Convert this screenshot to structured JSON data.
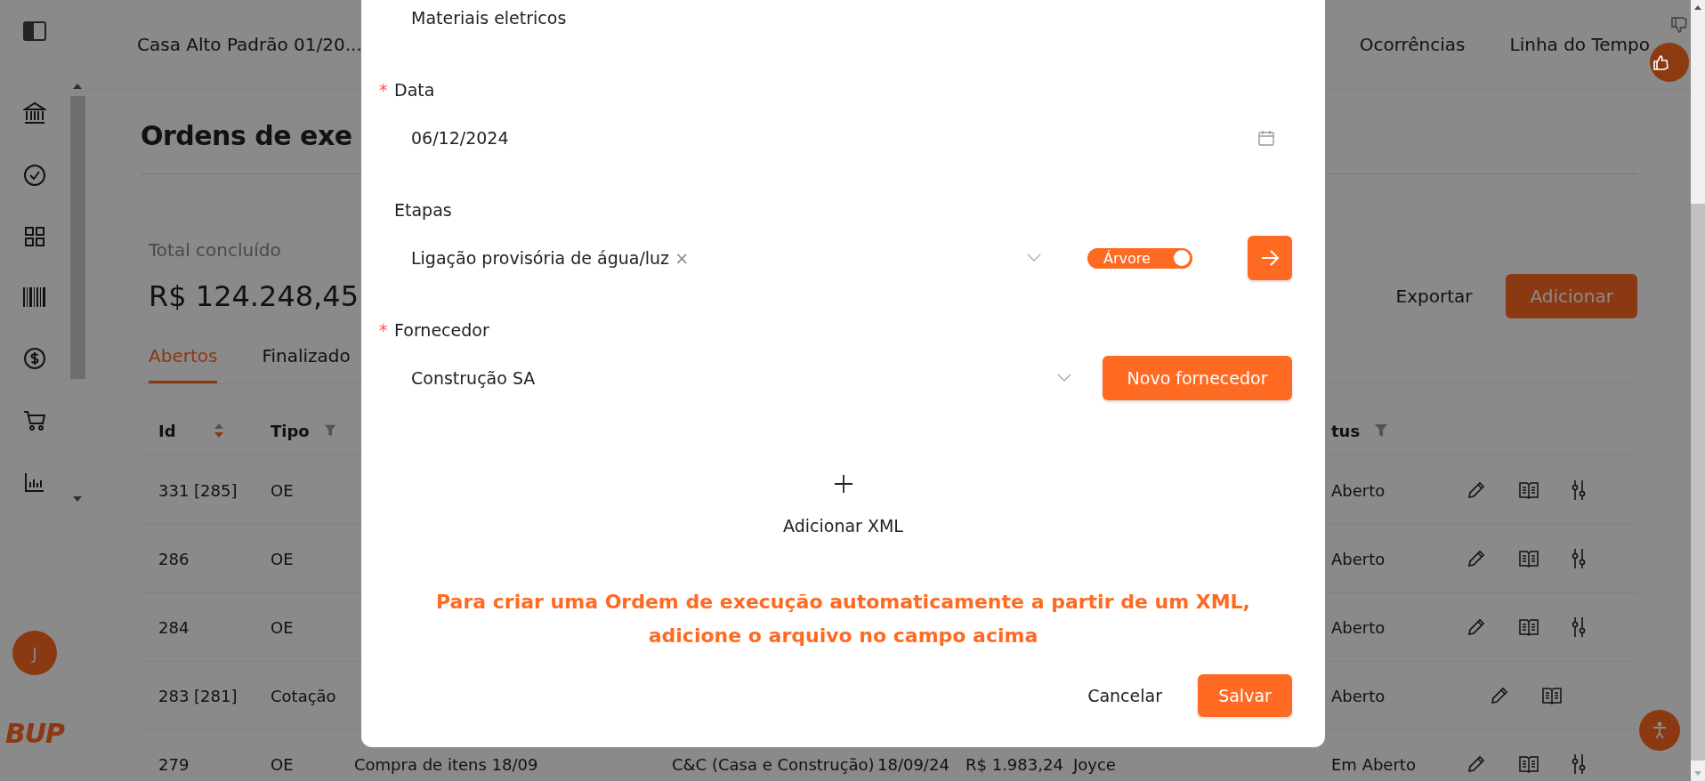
{
  "sidebar": {
    "avatar": "J",
    "logo": "BUP"
  },
  "header": {
    "project": "Casa Alto Padrão 01/20...",
    "nav": [
      "Ocorrências",
      "Linha do Tempo"
    ]
  },
  "page": {
    "title": "Ordens de exe",
    "total_label": "Total concluído",
    "total_value": "R$ 124.248,45",
    "tabs": [
      {
        "label": "Abertos",
        "selected": true
      },
      {
        "label": "Finalizado",
        "selected": false
      }
    ],
    "export": "Exportar",
    "add": "Adicionar"
  },
  "table": {
    "columns": [
      {
        "label": "Id",
        "sort_descending": true
      },
      {
        "label": "Tipo",
        "filter": true
      },
      {
        "label": "tus",
        "filter": true
      }
    ],
    "rows": [
      {
        "id": "331 [285]",
        "tipo": "OE",
        "status": "Aberto",
        "actions": [
          {
            "kind": "edit"
          },
          {
            "kind": "book"
          },
          {
            "kind": "sliders"
          }
        ]
      },
      {
        "id": "286",
        "tipo": "OE",
        "status": "Aberto",
        "actions": [
          {
            "kind": "edit"
          },
          {
            "kind": "book"
          },
          {
            "kind": "sliders"
          }
        ]
      },
      {
        "id": "284",
        "tipo": "OE",
        "status": "Aberto",
        "actions": [
          {
            "kind": "edit"
          },
          {
            "kind": "book"
          },
          {
            "kind": "sliders"
          }
        ]
      },
      {
        "id": "283 [281]",
        "tipo": "Cotação",
        "status": "Aberto",
        "actions": [
          {
            "kind": "edit"
          },
          {
            "kind": "book"
          }
        ]
      },
      {
        "id": "279",
        "tipo": "OE",
        "description": "Compra de itens 18/09",
        "supplier": "C&C (Casa e Construção)",
        "date": "18/09/24",
        "value": "R$ 1.983,24",
        "responsible": "Joyce",
        "status": "Em Aberto",
        "actions": [
          {
            "kind": "edit"
          },
          {
            "kind": "book"
          },
          {
            "kind": "sliders"
          }
        ]
      }
    ]
  },
  "modal": {
    "fields": [
      {
        "kind": "text",
        "value": "Materiais eletricos"
      },
      {
        "kind": "date",
        "label": "Data",
        "required_mark": "*",
        "value": "06/12/2024"
      },
      {
        "kind": "tags",
        "label": "Etapas",
        "tags": [
          {
            "label": "Ligação provisória de água/luz",
            "remove": "×"
          }
        ],
        "toggle": {
          "label": "Árvore",
          "on": true
        }
      },
      {
        "kind": "select",
        "label": "Fornecedor",
        "required_mark": "*",
        "value": "Construção SA",
        "button": "Novo fornecedor"
      }
    ],
    "upload": {
      "label": "Adicionar XML"
    },
    "hint": [
      "Para criar uma Ordem de execução automaticamente a partir de um XML,",
      "adicione o arquivo no campo acima"
    ],
    "buttons": [
      {
        "label": "Cancelar",
        "kind": "secondary"
      },
      {
        "label": "Salvar",
        "kind": "primary"
      }
    ]
  }
}
